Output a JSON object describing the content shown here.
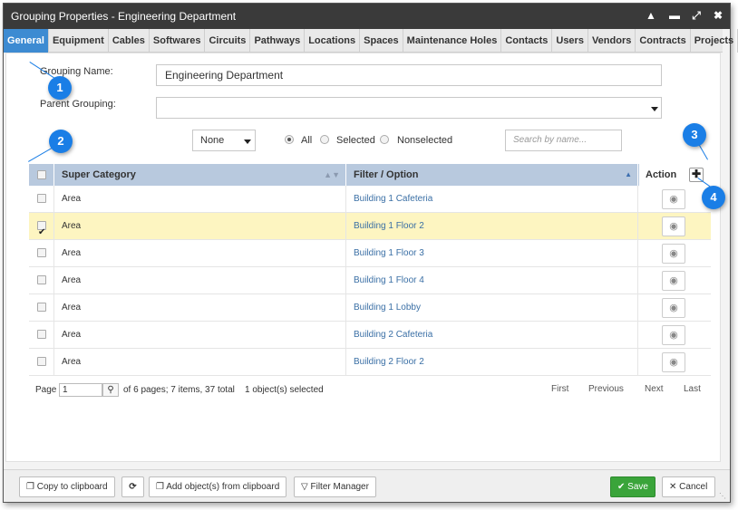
{
  "window": {
    "title": "Grouping Properties - Engineering Department",
    "controls": [
      "chevron-up-icon",
      "minimize-icon",
      "maximize-icon",
      "close-icon"
    ]
  },
  "tabs": [
    "General",
    "Equipment",
    "Cables",
    "Softwares",
    "Circuits",
    "Pathways",
    "Locations",
    "Spaces",
    "Maintenance Holes",
    "Contacts",
    "Users",
    "Vendors",
    "Contracts",
    "Projects"
  ],
  "form": {
    "grouping_name_label": "Grouping Name:",
    "grouping_name_value": "Engineering Department",
    "parent_grouping_label": "Parent Grouping:",
    "parent_grouping_value": ""
  },
  "filters": {
    "dropdown_value": "None",
    "radio_all": "All",
    "radio_selected": "Selected",
    "radio_nonselected": "Nonselected",
    "search_placeholder": "Search by name..."
  },
  "grid": {
    "headers": {
      "super_category": "Super Category",
      "filter_option": "Filter / Option",
      "action": "Action"
    },
    "rows": [
      {
        "category": "Area",
        "option": "Building 1 Cafeteria",
        "checked": false
      },
      {
        "category": "Area",
        "option": "Building 1 Floor 2",
        "checked": true
      },
      {
        "category": "Area",
        "option": "Building 1 Floor 3",
        "checked": false
      },
      {
        "category": "Area",
        "option": "Building 1 Floor 4",
        "checked": false
      },
      {
        "category": "Area",
        "option": "Building 1 Lobby",
        "checked": false
      },
      {
        "category": "Area",
        "option": "Building 2 Cafeteria",
        "checked": false
      },
      {
        "category": "Area",
        "option": "Building 2 Floor 2",
        "checked": false
      }
    ]
  },
  "pager": {
    "page_label": "Page",
    "page_value": "1",
    "info": "of 6 pages; 7 items, 37 total",
    "selected_info": "1 object(s) selected",
    "first": "First",
    "previous": "Previous",
    "next": "Next",
    "last": "Last"
  },
  "footer": {
    "copy": "Copy to clipboard",
    "add_from_clipboard": "Add object(s) from clipboard",
    "filter_manager": "Filter Manager",
    "save": "Save",
    "cancel": "Cancel"
  },
  "callouts": [
    "1",
    "2",
    "3",
    "4"
  ],
  "colors": {
    "active_tab": "#3d8bd2",
    "grid_header": "#b8c9de",
    "selected_row": "#fdf5c1",
    "save_button": "#3aa43a",
    "callout": "#1a7ee6"
  }
}
